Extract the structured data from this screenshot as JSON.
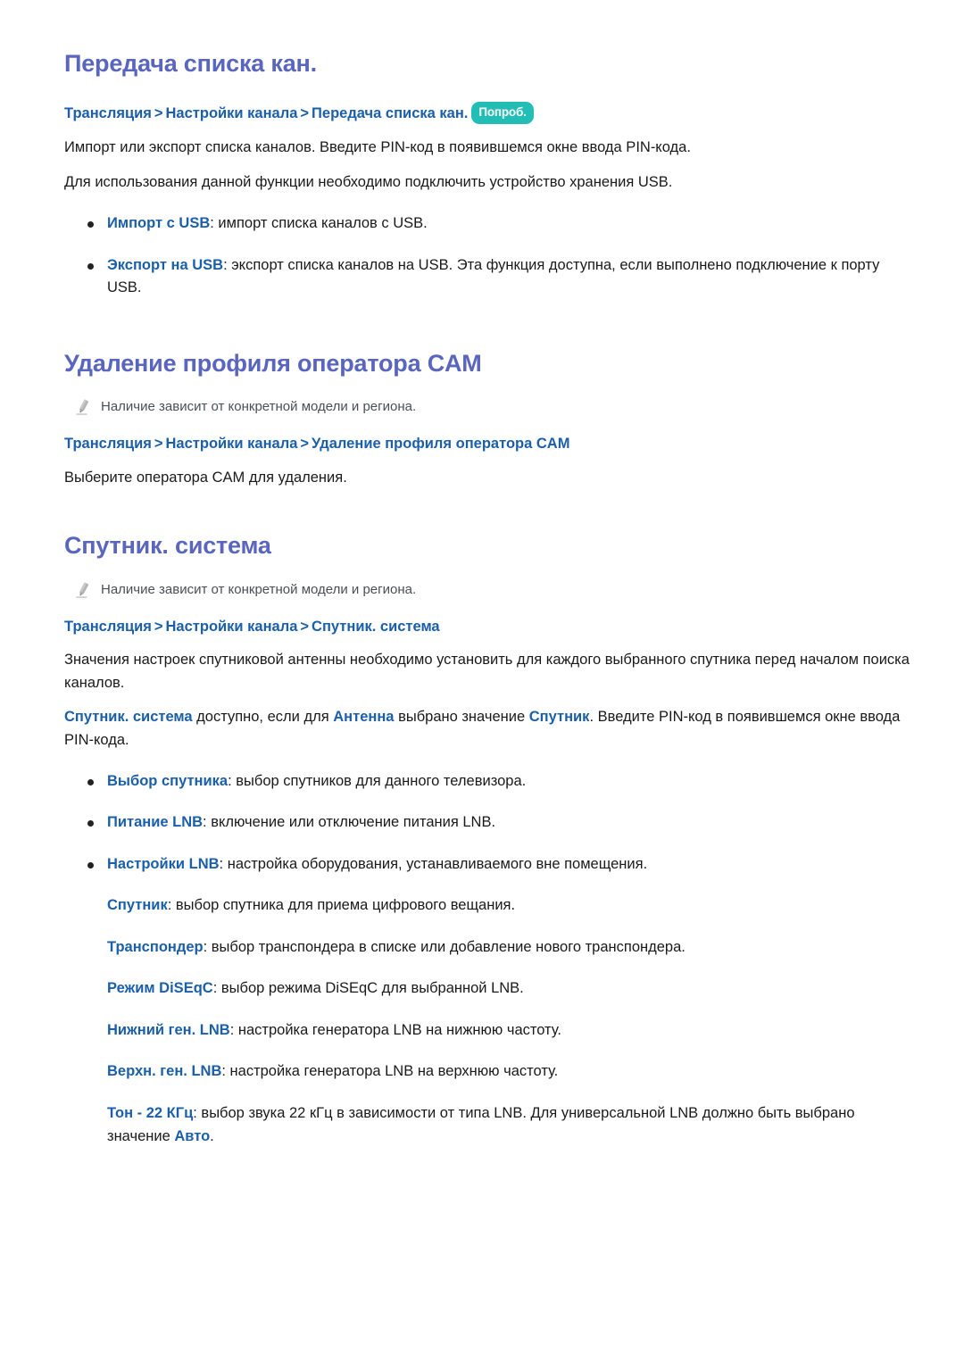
{
  "document": {
    "language": "ru",
    "colors": {
      "heading": "#5a66bd",
      "link": "#1b5faa",
      "badge_bg": "#22bdb5",
      "badge_text": "#ffffff",
      "body_text": "#1a1a1a",
      "note_text": "#4a4f57",
      "background": "#ffffff"
    },
    "icons": {
      "pencil": "pencil-icon",
      "breadcrumb_separator": ">",
      "bullet": "•"
    }
  },
  "sections": [
    {
      "id": "channel-list-transfer",
      "title": "Передача списка кан.",
      "breadcrumb": {
        "parts": [
          "Трансляция",
          "Настройки канала",
          "Передача списка кан."
        ],
        "separator": ">",
        "badge": "Попроб."
      },
      "paragraphs": [
        "Импорт или экспорт списка каналов. Введите PIN-код в появившемся окне ввода PIN-кода.",
        "Для использования данной функции необходимо подключить устройство хранения USB."
      ],
      "bullets": [
        {
          "term": "Импорт с USB",
          "text": ": импорт списка каналов с USB."
        },
        {
          "term": "Экспорт на USB",
          "text": ": экспорт списка каналов на USB. Эта функция доступна, если выполнено подключение к порту USB."
        }
      ]
    },
    {
      "id": "cam-operator-profile-delete",
      "title": "Удаление профиля оператора CAM",
      "note": "Наличие зависит от конкретной модели и региона.",
      "breadcrumb": {
        "parts": [
          "Трансляция",
          "Настройки канала",
          "Удаление профиля оператора CAM"
        ],
        "separator": ">"
      },
      "paragraphs": [
        "Выберите оператора CAM для удаления."
      ]
    },
    {
      "id": "satellite-system",
      "title": "Спутник. система",
      "note": "Наличие зависит от конкретной модели и региона.",
      "breadcrumb": {
        "parts": [
          "Трансляция",
          "Настройки канала",
          "Спутник. система"
        ],
        "separator": ">"
      },
      "paragraphs": [
        "Значения настроек спутниковой антенны необходимо установить для каждого выбранного спутника перед началом поиска каналов."
      ],
      "availability_note": {
        "lead_term": "Спутник. система",
        "text_1": " доступно, если для ",
        "term_2": "Антенна",
        "text_2": " выбрано значение ",
        "term_3": "Спутник",
        "text_3": ". Введите PIN-код в появившемся окне ввода PIN-кода."
      },
      "bullets": [
        {
          "term": "Выбор спутника",
          "text": ": выбор спутников для данного телевизора."
        },
        {
          "term": "Питание LNB",
          "text": ": включение или отключение питания LNB."
        },
        {
          "term": "Настройки LNB",
          "text": ": настройка оборудования, устанавливаемого вне помещения."
        }
      ],
      "sub_items": [
        {
          "term": "Спутник",
          "text": ": выбор спутника для приема цифрового вещания."
        },
        {
          "term": "Транспондер",
          "text": ": выбор транспондера в списке или добавление нового транспондера."
        },
        {
          "term": "Режим DiSEqC",
          "text": ": выбор режима DiSEqC для выбранной LNB."
        },
        {
          "term": "Нижний ген. LNB",
          "text": ": настройка генератора LNB на нижнюю частоту."
        },
        {
          "term": "Верхн. ген. LNB",
          "text": ": настройка генератора LNB на верхнюю частоту."
        }
      ],
      "final_item": {
        "term": "Тон - 22 КГц",
        "text_1": ": выбор звука 22 кГц в зависимости от типа LNB. Для универсальной LNB должно быть выбрано значение ",
        "term_2": "Авто",
        "text_2": "."
      }
    }
  ]
}
